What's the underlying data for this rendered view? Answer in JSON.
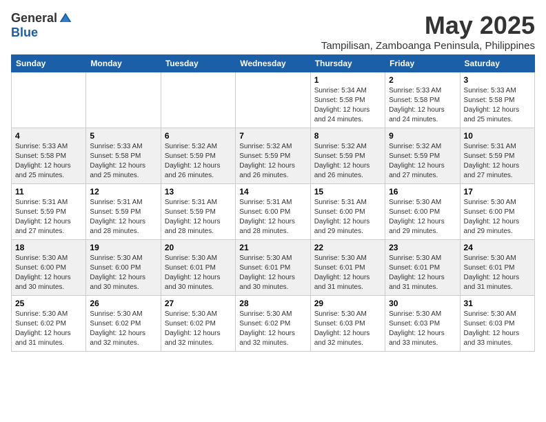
{
  "header": {
    "logo_general": "General",
    "logo_blue": "Blue",
    "title": "May 2025",
    "subtitle": "Tampilisan, Zamboanga Peninsula, Philippines"
  },
  "weekdays": [
    "Sunday",
    "Monday",
    "Tuesday",
    "Wednesday",
    "Thursday",
    "Friday",
    "Saturday"
  ],
  "weeks": [
    [
      {
        "day": "",
        "info": ""
      },
      {
        "day": "",
        "info": ""
      },
      {
        "day": "",
        "info": ""
      },
      {
        "day": "",
        "info": ""
      },
      {
        "day": "1",
        "info": "Sunrise: 5:34 AM\nSunset: 5:58 PM\nDaylight: 12 hours\nand 24 minutes."
      },
      {
        "day": "2",
        "info": "Sunrise: 5:33 AM\nSunset: 5:58 PM\nDaylight: 12 hours\nand 24 minutes."
      },
      {
        "day": "3",
        "info": "Sunrise: 5:33 AM\nSunset: 5:58 PM\nDaylight: 12 hours\nand 25 minutes."
      }
    ],
    [
      {
        "day": "4",
        "info": "Sunrise: 5:33 AM\nSunset: 5:58 PM\nDaylight: 12 hours\nand 25 minutes."
      },
      {
        "day": "5",
        "info": "Sunrise: 5:33 AM\nSunset: 5:58 PM\nDaylight: 12 hours\nand 25 minutes."
      },
      {
        "day": "6",
        "info": "Sunrise: 5:32 AM\nSunset: 5:59 PM\nDaylight: 12 hours\nand 26 minutes."
      },
      {
        "day": "7",
        "info": "Sunrise: 5:32 AM\nSunset: 5:59 PM\nDaylight: 12 hours\nand 26 minutes."
      },
      {
        "day": "8",
        "info": "Sunrise: 5:32 AM\nSunset: 5:59 PM\nDaylight: 12 hours\nand 26 minutes."
      },
      {
        "day": "9",
        "info": "Sunrise: 5:32 AM\nSunset: 5:59 PM\nDaylight: 12 hours\nand 27 minutes."
      },
      {
        "day": "10",
        "info": "Sunrise: 5:31 AM\nSunset: 5:59 PM\nDaylight: 12 hours\nand 27 minutes."
      }
    ],
    [
      {
        "day": "11",
        "info": "Sunrise: 5:31 AM\nSunset: 5:59 PM\nDaylight: 12 hours\nand 27 minutes."
      },
      {
        "day": "12",
        "info": "Sunrise: 5:31 AM\nSunset: 5:59 PM\nDaylight: 12 hours\nand 28 minutes."
      },
      {
        "day": "13",
        "info": "Sunrise: 5:31 AM\nSunset: 5:59 PM\nDaylight: 12 hours\nand 28 minutes."
      },
      {
        "day": "14",
        "info": "Sunrise: 5:31 AM\nSunset: 6:00 PM\nDaylight: 12 hours\nand 28 minutes."
      },
      {
        "day": "15",
        "info": "Sunrise: 5:31 AM\nSunset: 6:00 PM\nDaylight: 12 hours\nand 29 minutes."
      },
      {
        "day": "16",
        "info": "Sunrise: 5:30 AM\nSunset: 6:00 PM\nDaylight: 12 hours\nand 29 minutes."
      },
      {
        "day": "17",
        "info": "Sunrise: 5:30 AM\nSunset: 6:00 PM\nDaylight: 12 hours\nand 29 minutes."
      }
    ],
    [
      {
        "day": "18",
        "info": "Sunrise: 5:30 AM\nSunset: 6:00 PM\nDaylight: 12 hours\nand 30 minutes."
      },
      {
        "day": "19",
        "info": "Sunrise: 5:30 AM\nSunset: 6:00 PM\nDaylight: 12 hours\nand 30 minutes."
      },
      {
        "day": "20",
        "info": "Sunrise: 5:30 AM\nSunset: 6:01 PM\nDaylight: 12 hours\nand 30 minutes."
      },
      {
        "day": "21",
        "info": "Sunrise: 5:30 AM\nSunset: 6:01 PM\nDaylight: 12 hours\nand 30 minutes."
      },
      {
        "day": "22",
        "info": "Sunrise: 5:30 AM\nSunset: 6:01 PM\nDaylight: 12 hours\nand 31 minutes."
      },
      {
        "day": "23",
        "info": "Sunrise: 5:30 AM\nSunset: 6:01 PM\nDaylight: 12 hours\nand 31 minutes."
      },
      {
        "day": "24",
        "info": "Sunrise: 5:30 AM\nSunset: 6:01 PM\nDaylight: 12 hours\nand 31 minutes."
      }
    ],
    [
      {
        "day": "25",
        "info": "Sunrise: 5:30 AM\nSunset: 6:02 PM\nDaylight: 12 hours\nand 31 minutes."
      },
      {
        "day": "26",
        "info": "Sunrise: 5:30 AM\nSunset: 6:02 PM\nDaylight: 12 hours\nand 32 minutes."
      },
      {
        "day": "27",
        "info": "Sunrise: 5:30 AM\nSunset: 6:02 PM\nDaylight: 12 hours\nand 32 minutes."
      },
      {
        "day": "28",
        "info": "Sunrise: 5:30 AM\nSunset: 6:02 PM\nDaylight: 12 hours\nand 32 minutes."
      },
      {
        "day": "29",
        "info": "Sunrise: 5:30 AM\nSunset: 6:03 PM\nDaylight: 12 hours\nand 32 minutes."
      },
      {
        "day": "30",
        "info": "Sunrise: 5:30 AM\nSunset: 6:03 PM\nDaylight: 12 hours\nand 33 minutes."
      },
      {
        "day": "31",
        "info": "Sunrise: 5:30 AM\nSunset: 6:03 PM\nDaylight: 12 hours\nand 33 minutes."
      }
    ]
  ]
}
